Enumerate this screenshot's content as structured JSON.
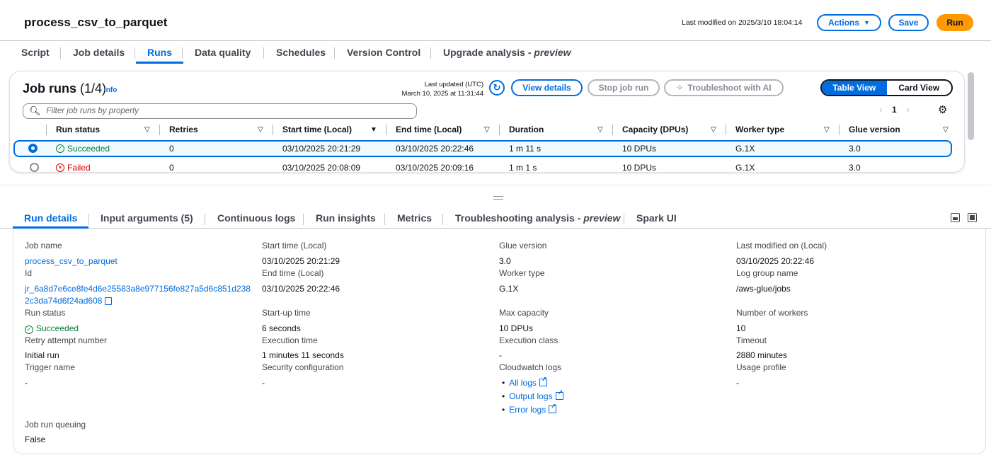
{
  "header": {
    "title": "process_csv_to_parquet",
    "last_modified": "Last modified on 2025/3/10 18:04:14",
    "actions_label": "Actions",
    "save_label": "Save",
    "run_label": "Run"
  },
  "tabs": [
    "Script",
    "Job details",
    "Runs",
    "Data quality",
    "Schedules",
    "Version Control",
    "Upgrade analysis - ",
    "preview"
  ],
  "runs": {
    "title": "Job runs",
    "count": "(1/4)",
    "info": "Info",
    "last_updated_label": "Last updated (UTC)",
    "last_updated_value": "March 10, 2025 at 11:31:44",
    "view_details": "View details",
    "stop_job_run": "Stop job run",
    "troubleshoot": "Troubleshoot with AI",
    "table_view": "Table View",
    "card_view": "Card View",
    "filter_placeholder": "Filter job runs by property",
    "page": "1",
    "columns": [
      "Run status",
      "Retries",
      "Start time (Local)",
      "End time (Local)",
      "Duration",
      "Capacity (DPUs)",
      "Worker type",
      "Glue version"
    ],
    "rows": [
      {
        "status": "Succeeded",
        "retries": "0",
        "start": "03/10/2025 20:21:29",
        "end": "03/10/2025 20:22:46",
        "duration": "1 m 11 s",
        "capacity": "10 DPUs",
        "worker": "G.1X",
        "glue": "3.0"
      },
      {
        "status": "Failed",
        "retries": "0",
        "start": "03/10/2025 20:08:09",
        "end": "03/10/2025 20:09:16",
        "duration": "1 m 1 s",
        "capacity": "10 DPUs",
        "worker": "G.1X",
        "glue": "3.0"
      }
    ]
  },
  "bottom_tabs": [
    "Run details",
    "Input arguments (5)",
    "Continuous logs",
    "Run insights",
    "Metrics",
    "Troubleshooting analysis - ",
    "preview",
    "Spark UI"
  ],
  "details": {
    "job_name_label": "Job name",
    "job_name": "process_csv_to_parquet",
    "id_label": "Id",
    "id_line1": "jr_6a8d7e6ce8fe4d6e25583a8e977156fe827a5d6c851d238",
    "id_line2": "2c3da74d6f24ad608",
    "run_status_label": "Run status",
    "run_status": "Succeeded",
    "retry_label": "Retry attempt number",
    "retry": "Initial run",
    "trigger_label": "Trigger name",
    "trigger": "-",
    "queuing_label": "Job run queuing",
    "queuing": "False",
    "start_label": "Start time (Local)",
    "start": "03/10/2025 20:21:29",
    "end_label": "End time (Local)",
    "end": "03/10/2025 20:22:46",
    "startup_label": "Start-up time",
    "startup": "6 seconds",
    "exec_label": "Execution time",
    "exec": "1 minutes 11 seconds",
    "security_label": "Security configuration",
    "security": "-",
    "glue_label": "Glue version",
    "glue": "3.0",
    "worker_label": "Worker type",
    "worker": "G.1X",
    "maxcap_label": "Max capacity",
    "maxcap": "10 DPUs",
    "execclass_label": "Execution class",
    "execclass": "-",
    "cw_label": "Cloudwatch logs",
    "cw_all": "All logs",
    "cw_output": "Output logs",
    "cw_error": "Error logs",
    "lastmod_label": "Last modified on (Local)",
    "lastmod": "03/10/2025 20:22:46",
    "loggroup_label": "Log group name",
    "loggroup": "/aws-glue/jobs",
    "workers_label": "Number of workers",
    "workers": "10",
    "timeout_label": "Timeout",
    "timeout": "2880 minutes",
    "usage_label": "Usage profile",
    "usage": "-"
  },
  "colors": {
    "accent": "#006ce0",
    "run_button": "#ff9900",
    "success": "#00802f",
    "error": "#db0000"
  }
}
